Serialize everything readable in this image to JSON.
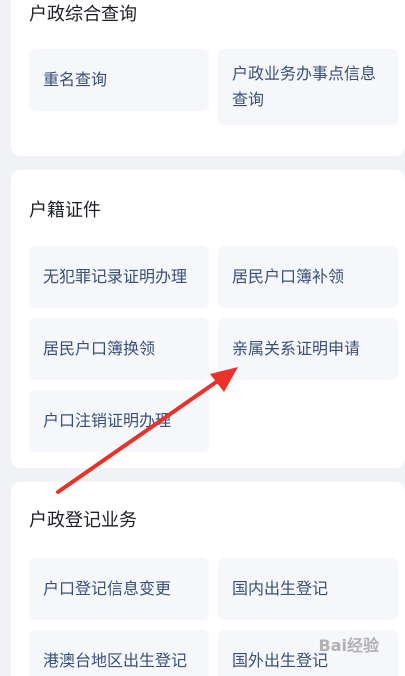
{
  "sections": [
    {
      "title": "户政综合查询",
      "items": [
        "重名查询",
        "户政业务办事点信息查询"
      ]
    },
    {
      "title": "户籍证件",
      "items": [
        "无犯罪记录证明办理",
        "居民户口簿补领",
        "居民户口簿换领",
        "亲属关系证明申请",
        "户口注销证明办理"
      ]
    },
    {
      "title": "户政登记业务",
      "items": [
        "户口登记信息变更",
        "国内出生登记",
        "港澳台地区出生登记",
        "国外出生登记"
      ]
    }
  ],
  "watermark": "Bai经验",
  "colors": {
    "background": "#f1f2f5",
    "card": "#ffffff",
    "tile": "#f6f7fb",
    "tile_text": "#3a4f78",
    "title_text": "#1c1f24",
    "arrow": "#e8322a"
  }
}
